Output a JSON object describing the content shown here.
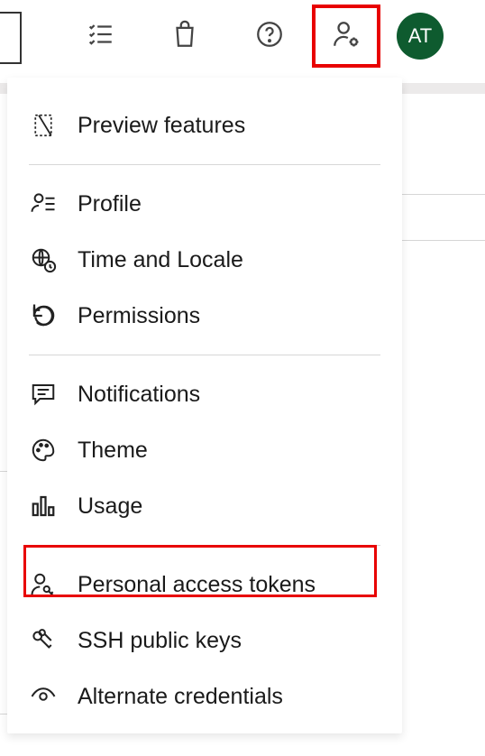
{
  "avatar": {
    "initials": "AT"
  },
  "menu": {
    "preview_features": "Preview features",
    "profile": "Profile",
    "time_locale": "Time and Locale",
    "permissions": "Permissions",
    "notifications": "Notifications",
    "theme": "Theme",
    "usage": "Usage",
    "pat": "Personal access tokens",
    "ssh": "SSH public keys",
    "alt_creds": "Alternate credentials"
  }
}
